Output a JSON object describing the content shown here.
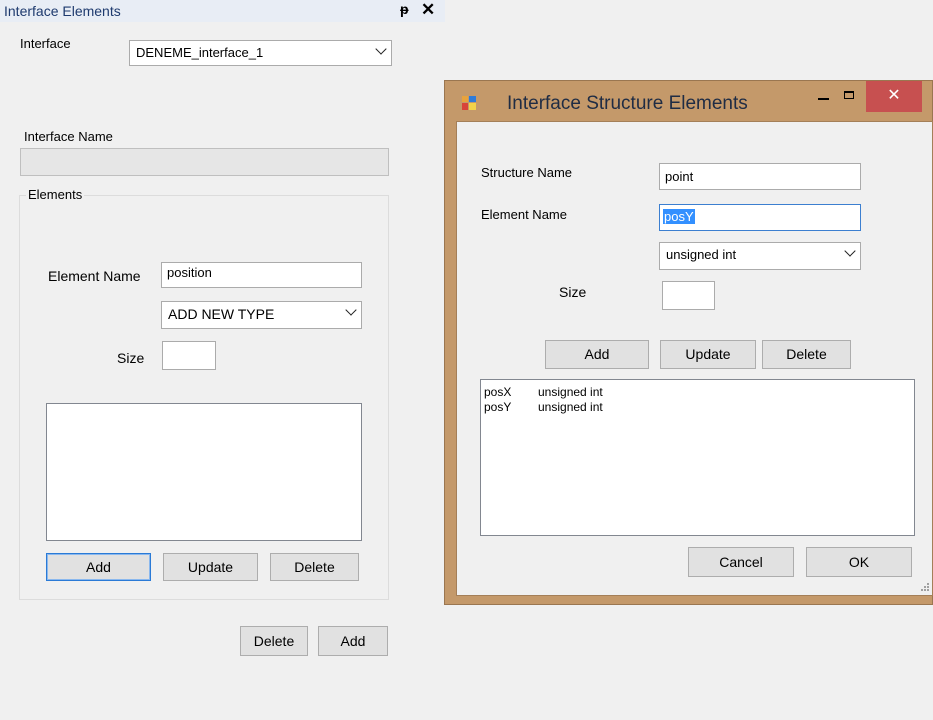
{
  "panel": {
    "title": "Interface Elements",
    "pin_glyph": "\u0002\u0004",
    "close_glyph": "✕",
    "interface_label": "Interface",
    "interface_value": "DENEME_interface_1",
    "interface_name_label": "Interface Name",
    "interface_name_value": "",
    "elements_group": "Elements",
    "element_name_label": "Element Name",
    "element_name_value": "position",
    "type_value": "ADD NEW TYPE",
    "size_label": "Size",
    "size_value": "",
    "add_label": "Add",
    "update_label": "Update",
    "delete_label": "Delete",
    "bottom_delete_label": "Delete",
    "bottom_add_label": "Add"
  },
  "dialog": {
    "title": "Interface Structure Elements",
    "structure_name_label": "Structure Name",
    "structure_name_value": "point",
    "element_name_label": "Element Name",
    "element_name_value": "posY",
    "type_value": "unsigned int",
    "size_label": "Size",
    "size_value": "",
    "add_label": "Add",
    "update_label": "Update",
    "delete_label": "Delete",
    "list": [
      {
        "name": "posX",
        "type": "unsigned int"
      },
      {
        "name": "posY",
        "type": "unsigned int"
      }
    ],
    "cancel_label": "Cancel",
    "ok_label": "OK",
    "close_glyph": "✕"
  }
}
